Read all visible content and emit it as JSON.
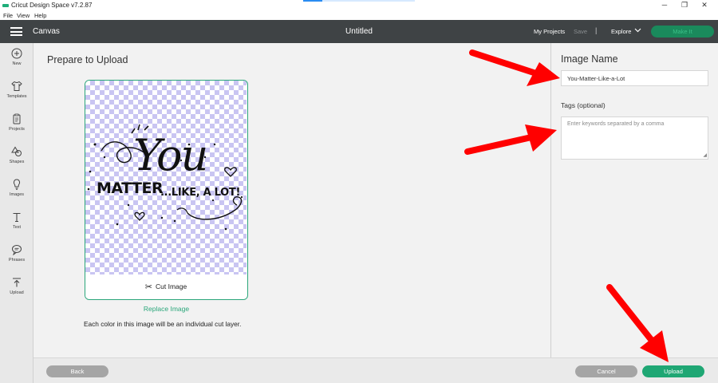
{
  "window": {
    "title": "Cricut Design Space  v7.2.87",
    "controls": {
      "minimize": "─",
      "restore": "❐",
      "close": "✕"
    }
  },
  "menu": [
    "File",
    "View",
    "Help"
  ],
  "header": {
    "section": "Canvas",
    "document_title": "Untitled",
    "my_projects": "My Projects",
    "save": "Save",
    "separator": "|",
    "explore": "Explore",
    "make_it": "Make It"
  },
  "sidebar": {
    "items": [
      {
        "label": "New",
        "icon": "plus-circle-icon"
      },
      {
        "label": "Templates",
        "icon": "shirt-icon"
      },
      {
        "label": "Projects",
        "icon": "clipboard-icon"
      },
      {
        "label": "Shapes",
        "icon": "shapes-icon"
      },
      {
        "label": "Images",
        "icon": "lightbulb-icon"
      },
      {
        "label": "Text",
        "icon": "text-icon"
      },
      {
        "label": "Phrases",
        "icon": "speech-bubble-icon"
      },
      {
        "label": "Upload",
        "icon": "upload-icon"
      }
    ]
  },
  "main": {
    "title": "Prepare to Upload",
    "preview_text": {
      "line1": "You",
      "line2": "MATTER",
      "line3": "...LIKE, A LOT!"
    },
    "cut_image_label": "Cut Image",
    "replace_image": "Replace Image",
    "info": "Each color in this image will be an individual cut layer."
  },
  "panel": {
    "image_name_label": "Image Name",
    "image_name_value": "You-Matter-Like-a-Lot",
    "tags_label": "Tags (optional)",
    "tags_placeholder": "Enter keywords separated by a comma"
  },
  "footer": {
    "back": "Back",
    "cancel": "Cancel",
    "upload": "Upload"
  },
  "colors": {
    "header_bg": "#3f4345",
    "accent_green": "#1fa774",
    "checker_lavender": "#c9c5f2",
    "annotation_red": "#ff0000"
  }
}
